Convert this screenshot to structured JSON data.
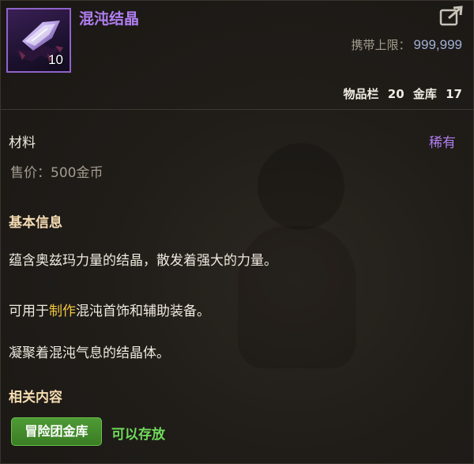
{
  "item": {
    "name": "混沌结晶",
    "count": "10",
    "icon": "chaos-crystal-icon",
    "name_color": "#b07ef0"
  },
  "header": {
    "carry_limit_label": "携带上限：",
    "carry_limit_value": "999,999",
    "inventory_label": "物品栏",
    "inventory_count": "20",
    "bank_label": "金库",
    "bank_count": "17"
  },
  "properties": {
    "category": "材料",
    "rarity": "稀有",
    "rarity_color": "#b07ef0",
    "price": "售价：500金币"
  },
  "basic_info": {
    "title": "基本信息",
    "line1": "蕴含奥兹玛力量的结晶，散发着强大的力量。",
    "line2_prefix": "可用于",
    "line2_highlight": "制作",
    "line2_suffix": "混沌首饰和辅助装备。",
    "line3": "凝聚着混沌气息的结晶体。",
    "highlight_color": "#f2c640"
  },
  "related": {
    "title": "相关内容",
    "button_label": "冒险团金库",
    "note": "可以存放",
    "button_color": "#4e9a35"
  }
}
